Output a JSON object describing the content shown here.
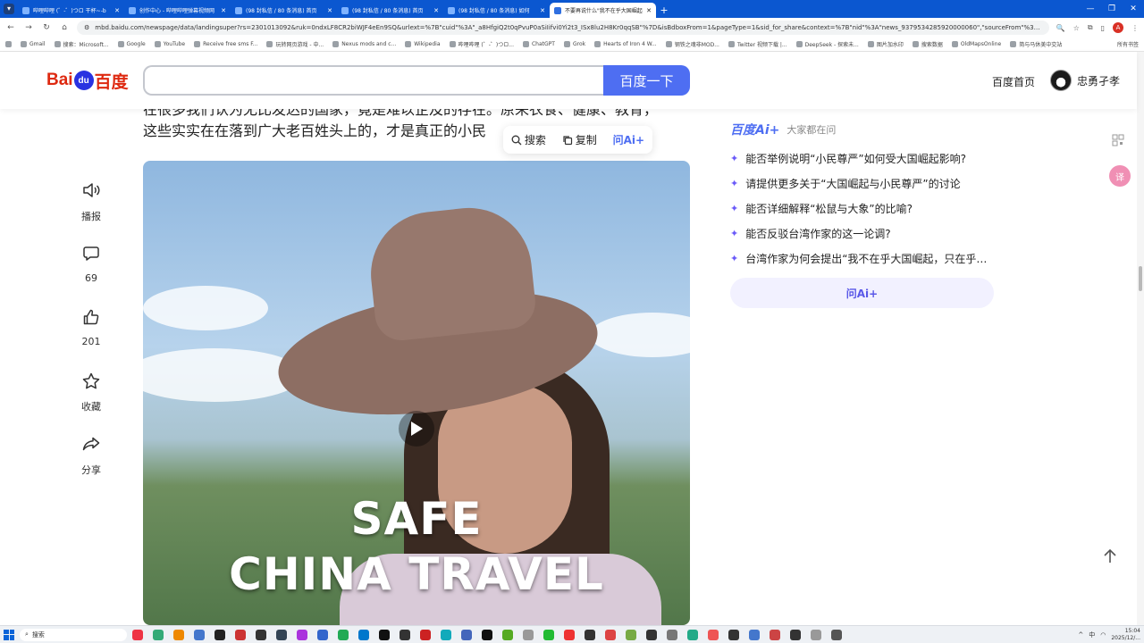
{
  "browser": {
    "tabs": [
      {
        "title": "哔哩哔哩 (゜-゜)つロ 干杯~-b",
        "active": false
      },
      {
        "title": "创作中心 - 哔哩哔哩弹幕视频网",
        "active": false
      },
      {
        "title": "(98 封私信 / 80 条消息) 首页",
        "active": false
      },
      {
        "title": "(98 封私信 / 80 条消息) 首页",
        "active": false
      },
      {
        "title": "(98 封私信 / 80 条消息) 如何",
        "active": false
      },
      {
        "title": "不要再说什么\"我不在乎大国崛起",
        "active": true
      }
    ],
    "url": "mbd.baidu.com/newspage/data/landingsuper?rs=2301013092&ruk=0ndxLF8CR2biWJF4eEn9SQ&urlext=%7B\"cuid\"%3A\"_a8HfgiQ2t0qPvuP0aSiIifvi0Yi2t3_ISx8lu2H8Kr0qqSB\"%7D&isBdboxFrom=1&pageType=1&sid_for_share&context=%7B\"nid\"%3A\"news_9379534285920000060\",\"sourceFrom\"%3A\"bjh\"%7D",
    "bookmarks": [
      "Gmail",
      "搜索：Microsoft...",
      "Google",
      "YouTube",
      "Receive free sms F...",
      "玩转网页游戏 - 中...",
      "Nexus mods and c...",
      "Wikipedia",
      "哔哩哔哩 (゜-゜)つロ...",
      "ChatGPT",
      "Grok",
      "Hearts of Iron 4 W...",
      "钢铁之魂非MOD...",
      "Twitter 视频下载 |...",
      "DeepSeek - 探索未...",
      "图片加水印",
      "搜索数据",
      "OldMapsOnline",
      "简与马休美中交站"
    ],
    "bookmarks_right": "所有书签"
  },
  "header": {
    "logo_text_left": "Bai",
    "logo_text_mid": "du",
    "logo_text_right": "百度",
    "search_button": "百度一下",
    "home_link": "百度首页",
    "username": "忠勇孑孝"
  },
  "article": {
    "line1_a": "在很多我们认为无比发达的国家，竟是难以企及的存在。原来衣食、",
    "line1_hl": "",
    "line1_b": "健康、教育，",
    "line2": "这些实实在在落到广大老百姓头上的，才是真正的小民",
    "selection_toolbar": {
      "search": "搜索",
      "copy": "复制",
      "ask_ai": "问Ai+"
    }
  },
  "sidebar": {
    "items": [
      {
        "label": "播报",
        "icon": "speaker-icon"
      },
      {
        "label": "69",
        "icon": "comment-icon"
      },
      {
        "label": "201",
        "icon": "thumbs-up-icon"
      },
      {
        "label": "收藏",
        "icon": "star-icon"
      },
      {
        "label": "分享",
        "icon": "share-icon"
      }
    ]
  },
  "video": {
    "overlay_line1": "SAFE",
    "overlay_line2": "CHINA TRAVEL"
  },
  "right_panel": {
    "brand": "百度Ai+",
    "subtitle": "大家都在问",
    "questions": [
      "能否举例说明“小民尊严”如何受大国崛起影响?",
      "请提供更多关于“大国崛起与小民尊严”的讨论",
      "能否详细解释“松鼠与大象”的比喻?",
      "能否反驳台湾作家的这一论调?",
      "台湾作家为何会提出“我不在乎大国崛起，只在乎…"
    ],
    "ask_button": "问Ai+"
  },
  "floating": {
    "translate": "译"
  },
  "taskbar": {
    "search_placeholder": "搜索",
    "ime": "中",
    "time": "15:04",
    "date": "2025/12/..."
  },
  "colors": {
    "accent": "#4e6ef2",
    "logo_red": "#de2910",
    "logo_blue": "#2932e1",
    "ai_purple": "#6a5af9",
    "chrome_blue": "#0b57d0"
  }
}
